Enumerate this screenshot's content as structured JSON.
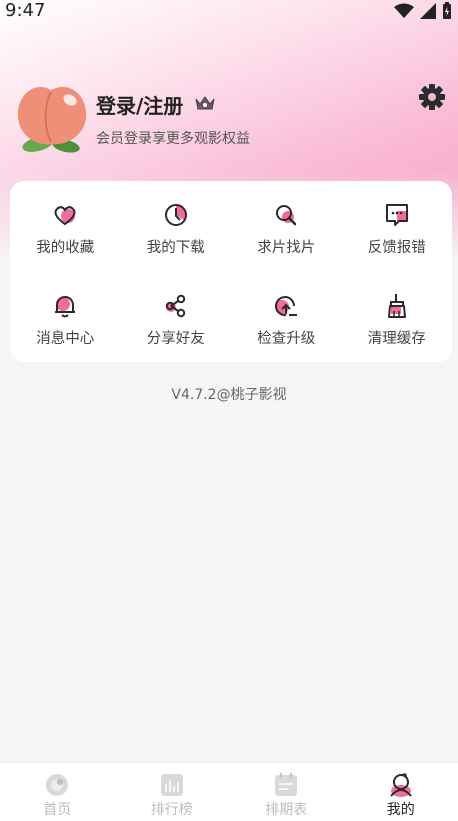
{
  "status_bar": {
    "time": "9:47"
  },
  "profile": {
    "title": "登录/注册",
    "subtitle": "会员登录享更多观影权益"
  },
  "features": [
    {
      "label": "我的收藏",
      "icon": "heart-icon"
    },
    {
      "label": "我的下载",
      "icon": "download-clock-icon"
    },
    {
      "label": "求片找片",
      "icon": "search-movie-icon"
    },
    {
      "label": "反馈报错",
      "icon": "feedback-chat-icon"
    },
    {
      "label": "消息中心",
      "icon": "bell-icon"
    },
    {
      "label": "分享好友",
      "icon": "share-icon"
    },
    {
      "label": "检查升级",
      "icon": "upgrade-icon"
    },
    {
      "label": "清理缓存",
      "icon": "broom-icon"
    }
  ],
  "version": "V4.7.2@桃子影视",
  "nav": [
    {
      "label": "首页",
      "icon": "home-icon",
      "active": false
    },
    {
      "label": "排行榜",
      "icon": "ranking-icon",
      "active": false
    },
    {
      "label": "排期表",
      "icon": "schedule-icon",
      "active": false
    },
    {
      "label": "我的",
      "icon": "profile-icon",
      "active": true
    }
  ],
  "colors": {
    "accent": "#f06ba0",
    "hero_pink": "#f7a6c8",
    "peach": "#ee8f78"
  }
}
